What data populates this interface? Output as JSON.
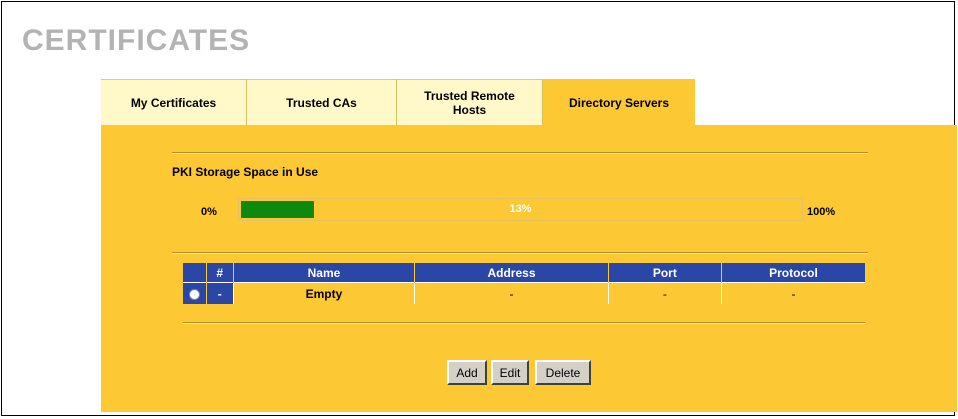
{
  "page": {
    "title": "CERTIFICATES"
  },
  "tabs": [
    {
      "label": "My Certificates"
    },
    {
      "label": "Trusted CAs"
    },
    {
      "label": "Trusted Remote Hosts"
    },
    {
      "label": "Directory Servers",
      "active": true
    }
  ],
  "storage": {
    "label": "PKI Storage Space in Use",
    "min_label": "0%",
    "max_label": "100%",
    "percent_text": "13%",
    "percent_value": 13,
    "fill_color": "#0d8a0d"
  },
  "table": {
    "columns": [
      "",
      "#",
      "Name",
      "Address",
      "Port",
      "Protocol"
    ],
    "rows": [
      {
        "index": "-",
        "name": "Empty",
        "address": "-",
        "port": "-",
        "protocol": "-"
      }
    ]
  },
  "buttons": {
    "add": "Add",
    "edit": "Edit",
    "delete": "Delete"
  },
  "colors": {
    "panel": "#fcc833",
    "tab_inactive": "#fff8c8",
    "header": "#2a47a8",
    "title": "#b3b3b3"
  }
}
